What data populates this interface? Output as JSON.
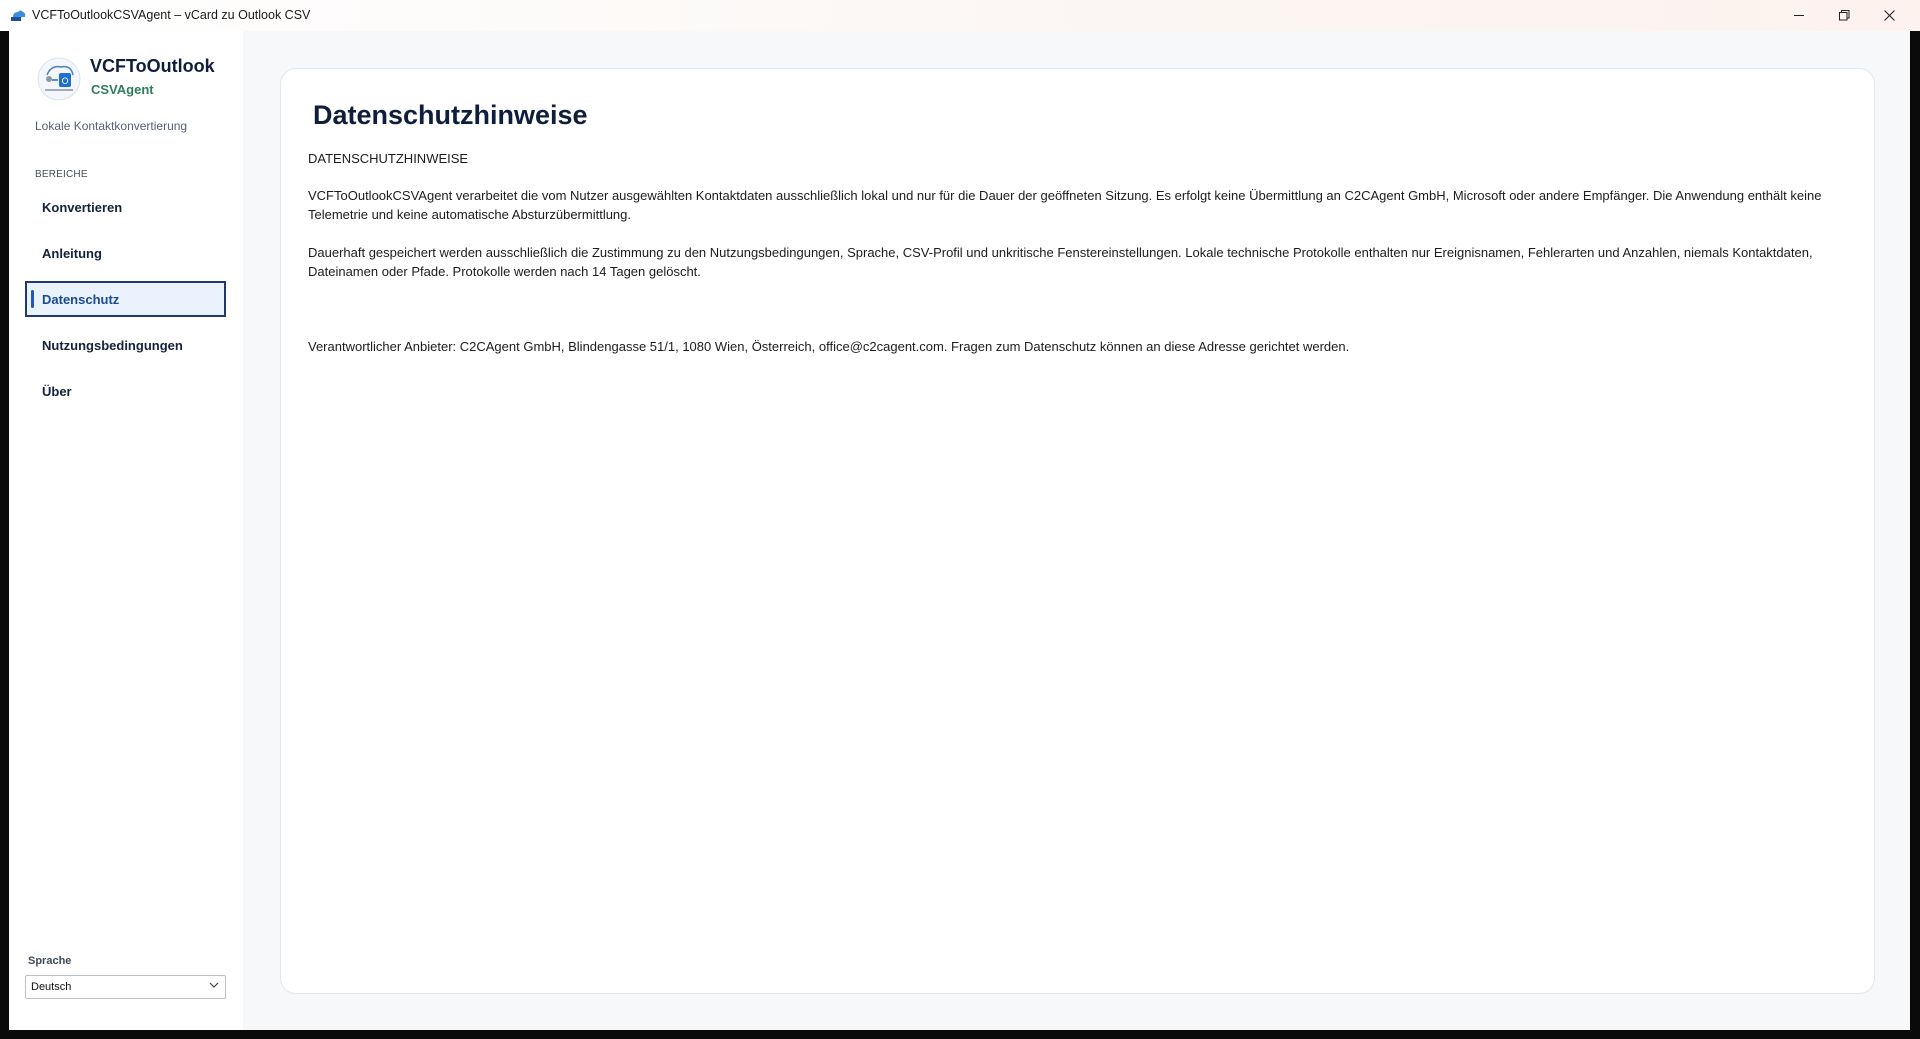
{
  "window": {
    "title": "VCFToOutlookCSVAgent – vCard zu Outlook CSV",
    "app_icon": "app-icon",
    "controls": {
      "minimize": "—",
      "maximize": "❐",
      "close": "✕"
    }
  },
  "sidebar": {
    "brand_title": "VCFToOutlook",
    "brand_subtitle": "CSVAgent",
    "description": "Lokale Kontaktkonvertierung",
    "section_label": "BEREICHE",
    "items": [
      {
        "label": "Konvertieren",
        "active": false
      },
      {
        "label": "Anleitung",
        "active": false
      },
      {
        "label": "Datenschutz",
        "active": true
      },
      {
        "label": "Nutzungsbedingungen",
        "active": false
      },
      {
        "label": "Über",
        "active": false
      }
    ],
    "language_label": "Sprache",
    "language_value": "Deutsch"
  },
  "content": {
    "title": "Datenschutzhinweise",
    "heading_caps": "DATENSCHUTZHINWEISE",
    "paragraph1": "VCFToOutlookCSVAgent verarbeitet die vom Nutzer ausgewählten Kontaktdaten ausschließlich lokal und nur für die Dauer der geöffneten Sitzung. Es erfolgt keine Übermittlung an C2CAgent GmbH, Microsoft oder andere Empfänger. Die Anwendung enthält keine Telemetrie und keine automatische Absturzübermittlung.",
    "paragraph2": "Dauerhaft gespeichert werden ausschließlich die Zustimmung zu den Nutzungsbedingungen, Sprache, CSV-Profil und unkritische Fenstereinstellungen. Lokale technische Protokolle enthalten nur Ereignisnamen, Fehlerarten und Anzahlen, niemals Kontaktdaten, Dateinamen oder Pfade. Protokolle werden nach 14 Tagen gelöscht.",
    "paragraph3": "Verantwortlicher Anbieter: C2CAgent GmbH, Blindengasse 51/1, 1080 Wien, Österreich, office@c2cagent.com. Fragen zum Datenschutz können an diese Adresse gerichtet werden."
  },
  "colors": {
    "accent": "#1e5bb8",
    "brand_green": "#2e7d5b",
    "title_navy": "#0f1e3c"
  }
}
